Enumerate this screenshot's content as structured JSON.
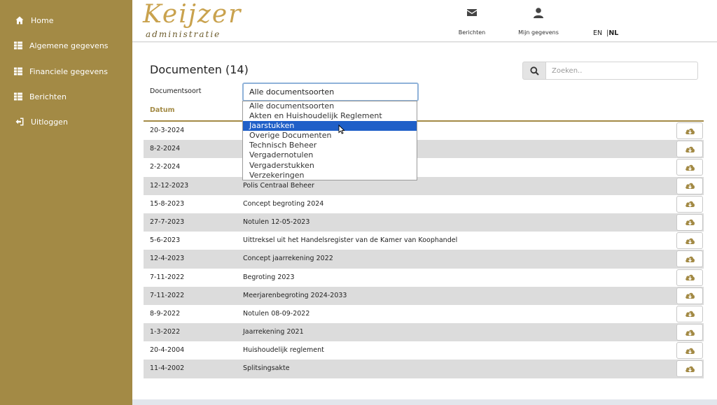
{
  "sidebar": {
    "items": [
      {
        "label": "Home",
        "icon": "home-icon"
      },
      {
        "label": "Algemene gegevens",
        "icon": "list-icon"
      },
      {
        "label": "Financiele gegevens",
        "icon": "list-icon"
      },
      {
        "label": "Berichten",
        "icon": "list-icon"
      },
      {
        "label": "Uitloggen",
        "icon": "logout-icon"
      }
    ]
  },
  "header": {
    "logo_main": "Keijzer",
    "logo_sub": "administratie",
    "berichten_label": "Berichten",
    "berichten_icon": "envelope-icon",
    "mijn_gegevens_label": "Mijn gegevens",
    "mijn_gegevens_icon": "user-icon",
    "lang_en": "EN",
    "lang_sep": "|",
    "lang_nl": "NL",
    "active_lang": "NL"
  },
  "main": {
    "title": "Documenten (14)",
    "search_placeholder": "Zoeken..",
    "filter_label": "Documentsoort",
    "filter_selected": "Alle documentsoorten",
    "column_datum": "Datum",
    "dropdown_options": [
      "Alle documentsoorten",
      "Akten en Huishoudelijk Reglement",
      "Jaarstukken",
      "Overige Documenten",
      "Technisch Beheer",
      "Vergadernotulen",
      "Vergaderstukken",
      "Verzekeringen"
    ],
    "dropdown_highlighted": "Jaarstukken",
    "rows": [
      {
        "date": "20-3-2024",
        "name": ""
      },
      {
        "date": "8-2-2024",
        "name": ""
      },
      {
        "date": "2-2-2024",
        "name": ""
      },
      {
        "date": "12-12-2023",
        "name": "Polis Centraal Beheer"
      },
      {
        "date": "15-8-2023",
        "name": "Concept begroting 2024"
      },
      {
        "date": "27-7-2023",
        "name": "Notulen 12-05-2023"
      },
      {
        "date": "5-6-2023",
        "name": "Uittreksel uit het Handelsregister van de Kamer van Koophandel"
      },
      {
        "date": "12-4-2023",
        "name": "Concept jaarrekening 2022"
      },
      {
        "date": "7-11-2022",
        "name": "Begroting 2023"
      },
      {
        "date": "7-11-2022",
        "name": "Meerjarenbegroting 2024-2033"
      },
      {
        "date": "8-9-2022",
        "name": "Notulen 08-09-2022"
      },
      {
        "date": "1-3-2022",
        "name": "Jaarrekening 2021"
      },
      {
        "date": "20-4-2004",
        "name": "Huishoudelijk reglement"
      },
      {
        "date": "11-4-2002",
        "name": "Splitsingsakte"
      }
    ],
    "download_icon": "cloud-download-icon"
  },
  "colors": {
    "sidebar_bg": "#a38a45",
    "accent": "#a38a45",
    "logo": "#c9a24e",
    "selection": "#1f5fc8"
  }
}
